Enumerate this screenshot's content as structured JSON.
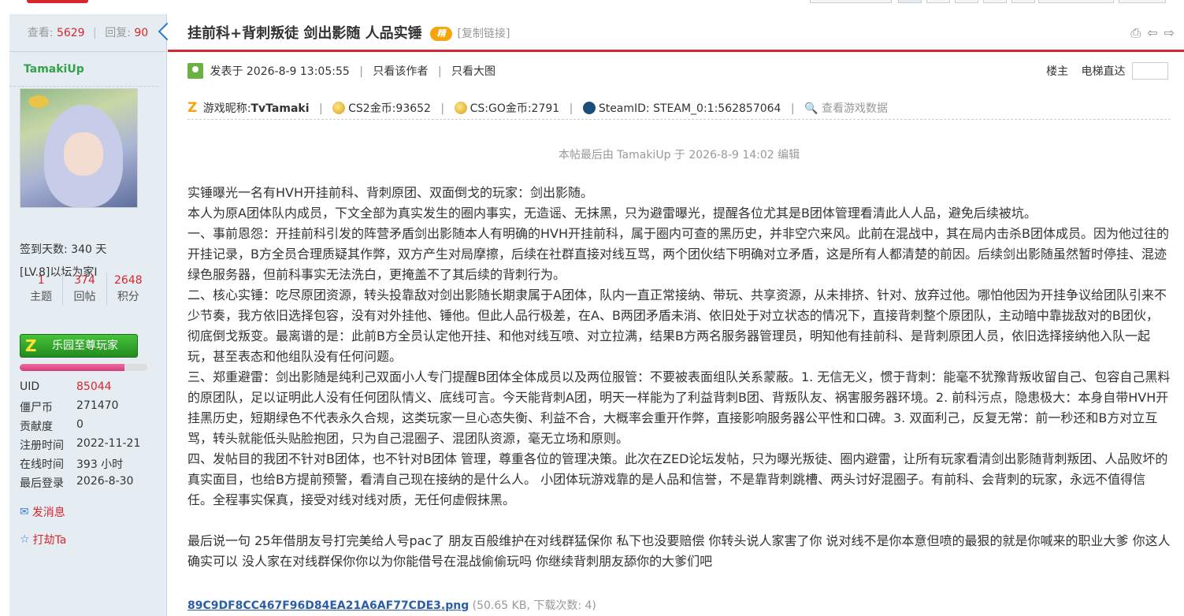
{
  "stats": {
    "views_label": "查看:",
    "views": "5629",
    "replies_label": "回复:",
    "replies": "90"
  },
  "thread": {
    "title": "挂前科+背刺叛徒 剑出影随 人品实锤",
    "badge": "精",
    "copy_link": "[复制链接]"
  },
  "author": {
    "name": "TamakiUp",
    "checkin": "签到天数: 340 天",
    "level": "[LV.8]以坛为家I",
    "counts": [
      {
        "value": "1",
        "label": "主题"
      },
      {
        "value": "374",
        "label": "回帖"
      },
      {
        "value": "2648",
        "label": "积分"
      }
    ],
    "medal": "乐园至尊玩家",
    "medal_icon": "Z",
    "progress_fraction": 0.82,
    "fields": [
      {
        "k": "UID",
        "v": "85044",
        "red": true
      },
      {
        "k": "僵尸币",
        "v": "271470",
        "red": false
      },
      {
        "k": "贡献度",
        "v": "0",
        "red": false
      },
      {
        "k": "注册时间",
        "v": "2022-11-21",
        "red": false
      },
      {
        "k": "在线时间",
        "v": "393 小时",
        "red": false
      },
      {
        "k": "最后登录",
        "v": "2026-8-30",
        "red": false
      }
    ],
    "actions": [
      {
        "icon": "mail-icon",
        "label": "发消息"
      },
      {
        "icon": "gun-icon",
        "label": "打劫Ta"
      }
    ]
  },
  "meta": {
    "posted": "发表于 2026-8-9 13:05:55",
    "only_author": "只看该作者",
    "only_images": "只看大图",
    "floor": "楼主",
    "elevator": "电梯直达"
  },
  "game": {
    "nickname_label": "游戏昵称:",
    "nickname": "TvTamaki",
    "cs2": "CS2金币:93652",
    "csgo": "CS:GO金币:2791",
    "steam": "SteamID: STEAM_0:1:562857064",
    "view_data": "查看游戏数据"
  },
  "edit_note": "本帖最后由 TamakiUp 于 2026-8-9 14:02 编辑",
  "content": [
    "实锤曝光一名有HVH开挂前科、背刺原团、双面倒戈的玩家：剑出影随。",
    "本人为原A团体队内成员，下文全部为真实发生的圈内事实，无造谣、无抹黑，只为避雷曝光，提醒各位尤其是B团体管理看清此人人品，避免后续被坑。",
    "一、事前恩怨：开挂前科引发的阵营矛盾剑出影随本人有明确的HVH开挂前科，属于圈内可查的黑历史，并非空穴来风。此前在混战中，其在局内击杀B团体成员。因为他过往的开挂记录，B方全员合理质疑其作弊，双方产生对局摩擦，后续在社群直接对线互骂，两个团伙结下明确对立矛盾，这是所有人都清楚的前因。后续剑出影随虽然暂时停挂、混迹绿色服务器，但前科事实无法洗白，更掩盖不了其后续的背刺行为。",
    "二、核心实锤：吃尽原团资源，转头投靠敌对剑出影随长期隶属于A团体，队内一直正常接纳、带玩、共享资源，从未排挤、针对、放弃过他。哪怕他因为开挂争议给团队引来不少节奏，我方依旧选择包容，没有对外挂他、锤他。但此人品行极差，在A、B两团矛盾未消、依旧处于对立状态的情况下，直接背刺整个原团队，主动暗中靠拢敌对的B团伙，彻底倒戈叛变。最离谱的是：此前B方全员认定他开挂、和他对线互喷、对立拉满，结果B方两名服务器管理员，明知他有挂前科、是背刺原团人员，依旧选择接纳他入队一起玩，甚至表态和他组队没有任何问题。",
    "三、郑重避雷：剑出影随是纯利己双面小人专门提醒B团体全体成员以及两位服管：不要被表面组队关系蒙蔽。1. 无信无义，惯于背刺：能毫不犹豫背叛收留自己、包容自己黑料的原团队，足以证明此人没有任何团队情义、底线可言。今天能背刺A团，明天一样能为了利益背刺B团、背叛队友、祸害服务器环境。2. 前科污点，隐患极大：本身自带HVH开挂黑历史，短期绿色不代表永久合规，这类玩家一旦心态失衡、利益不合，大概率会重开作弊，直接影响服务器公平性和口碑。3. 双面利己，反复无常：前一秒还和B方对立互骂，转头就能低头贴脸抱团，只为自己混圈子、混团队资源，毫无立场和原则。",
    "四、发帖目的我团不针对B团体，也不针对B团体 管理，尊重各位的管理决策。此次在ZED论坛发帖，只为曝光叛徒、圈内避雷，让所有玩家看清剑出影随背刺叛团、人品败坏的真实面目，也给B方提前预警，看清自己现在接纳的是什么人。 小团体玩游戏靠的是人品和信誉，不是靠背刺跳槽、两头讨好混圈子。有前科、会背刺的玩家，永远不值得信任。全程事实保真，接受对线对线对质，无任何虚假抹黑。",
    "",
    "最后说一句 25年借朋友号打完美给人号pac了 朋友百般维护在对线群猛保你 私下也没要赔偿 你转头说人家害了你 说对线不是你本意但喷的最狠的就是你喊来的职业大爹 你这人确实可以 没人家在对线群保你你以为你能借号在混战偷偷玩吗 你继续背刺朋友舔你的大爹们吧"
  ],
  "attachment": {
    "filename": "89C9DF8CC467F96D84EA21A6AF77CDE3.png",
    "info": "(50.65 KB, 下载次数: 4)"
  },
  "colors": {
    "accent": "#d8262f",
    "sidebar_bg": "#e5edf2",
    "name_green": "#33a04a"
  }
}
